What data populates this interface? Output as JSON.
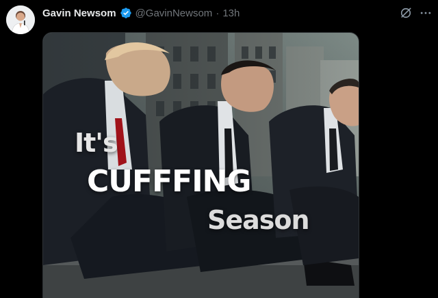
{
  "post": {
    "author_name": "Gavin Newsom",
    "author_handle": "@GavinNewsom",
    "separator": "·",
    "timestamp": "13h",
    "verified": true,
    "verified_color": "#1d9bf0"
  },
  "media": {
    "overlay": {
      "line1": "It's",
      "line2": "CUFFFING",
      "line3": "Season"
    }
  },
  "icons": {
    "avatar": "avatar",
    "verified": "verified-badge-icon",
    "grok": "grok-icon",
    "more": "more-options-icon"
  },
  "colors": {
    "background": "#000000",
    "text_primary": "#e7e9ea",
    "text_secondary": "#71767b"
  }
}
